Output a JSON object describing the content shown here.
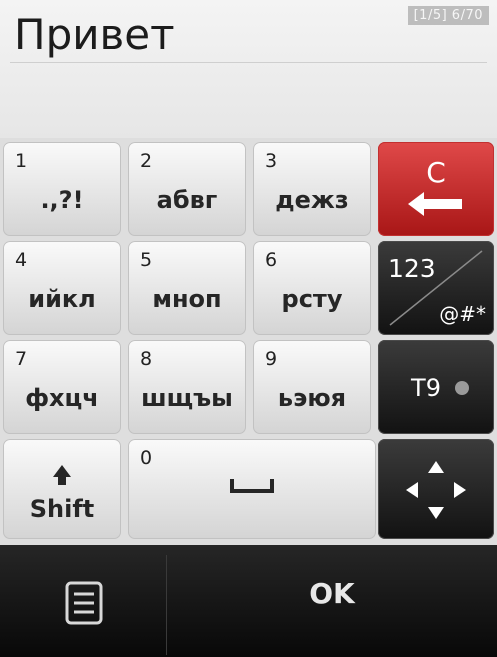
{
  "input": {
    "text": "Привет",
    "counter": "[1/5]  6/70"
  },
  "keys": [
    {
      "number": "1",
      "letters": ".,?!"
    },
    {
      "number": "2",
      "letters": "абвг"
    },
    {
      "number": "3",
      "letters": "дежз"
    },
    {
      "number": "4",
      "letters": "ийкл"
    },
    {
      "number": "5",
      "letters": "мноп"
    },
    {
      "number": "6",
      "letters": "рсту"
    },
    {
      "number": "7",
      "letters": "фхцч"
    },
    {
      "number": "8",
      "letters": "шщъы"
    },
    {
      "number": "9",
      "letters": "ьэюя"
    }
  ],
  "shift": {
    "label": "Shift"
  },
  "space": {
    "number": "0"
  },
  "clear": {
    "label": "C"
  },
  "mode": {
    "top": "123",
    "bottom": "@#*"
  },
  "t9": {
    "label": "T9"
  },
  "softkeys": {
    "ok": "OK"
  }
}
